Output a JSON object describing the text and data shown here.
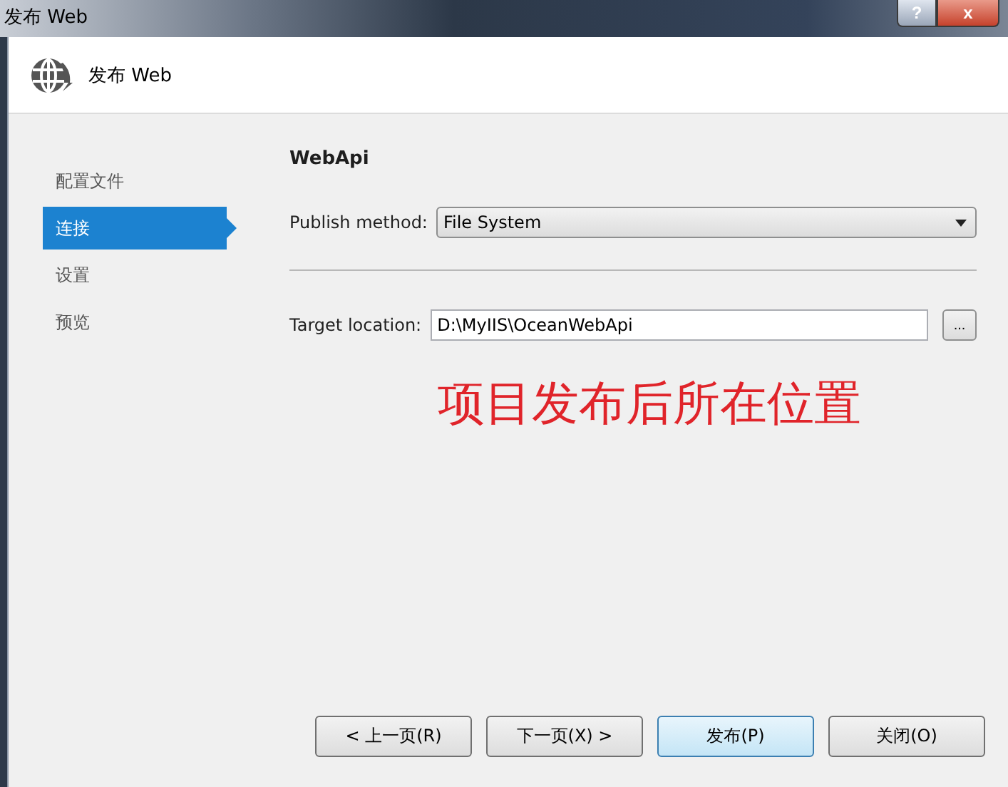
{
  "window": {
    "title": "发布 Web",
    "help": "?",
    "close": "x"
  },
  "header": {
    "title": "发布 Web"
  },
  "sidebar": {
    "items": [
      {
        "label": "配置文件",
        "selected": false
      },
      {
        "label": "连接",
        "selected": true
      },
      {
        "label": "设置",
        "selected": false
      },
      {
        "label": "预览",
        "selected": false
      }
    ]
  },
  "profile_name": "WebApi",
  "publish_method": {
    "label": "Publish method:",
    "value": "File System"
  },
  "target_location": {
    "label": "Target location:",
    "value": "D:\\MyIIS\\OceanWebApi",
    "browse": "..."
  },
  "annotation": "项目发布后所在位置",
  "buttons": [
    {
      "label": "< 上一页(R)",
      "selected": false
    },
    {
      "label": "下一页(X) >",
      "selected": false
    },
    {
      "label": "发布(P)",
      "selected": true
    },
    {
      "label": "关闭(O)",
      "selected": false
    }
  ]
}
